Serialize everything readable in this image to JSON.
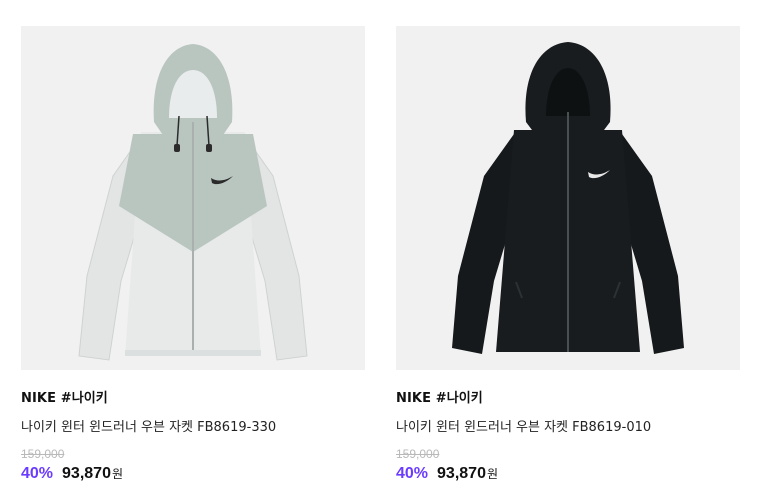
{
  "products": [
    {
      "brand": "NIKE #나이키",
      "name": "나이키 윈터 윈드러너 우븐 자켓 FB8619-330",
      "original_price": "159,000",
      "discount": "40%",
      "price": "93,870",
      "currency": "원",
      "image_icon": "jacket-light-grey-icon",
      "colors": {
        "body": "#e6e8e8",
        "yoke": "#b9c6c0",
        "trim": "#2b2b2b"
      }
    },
    {
      "brand": "NIKE #나이키",
      "name": "나이키 윈터 윈드러너 우븐 자켓 FB8619-010",
      "original_price": "159,000",
      "discount": "40%",
      "price": "93,870",
      "currency": "원",
      "image_icon": "jacket-black-icon",
      "colors": {
        "body": "#161a1c",
        "yoke": "#161a1c",
        "trim": "#e8e8e8"
      }
    }
  ],
  "accent_color": "#6b3cff"
}
